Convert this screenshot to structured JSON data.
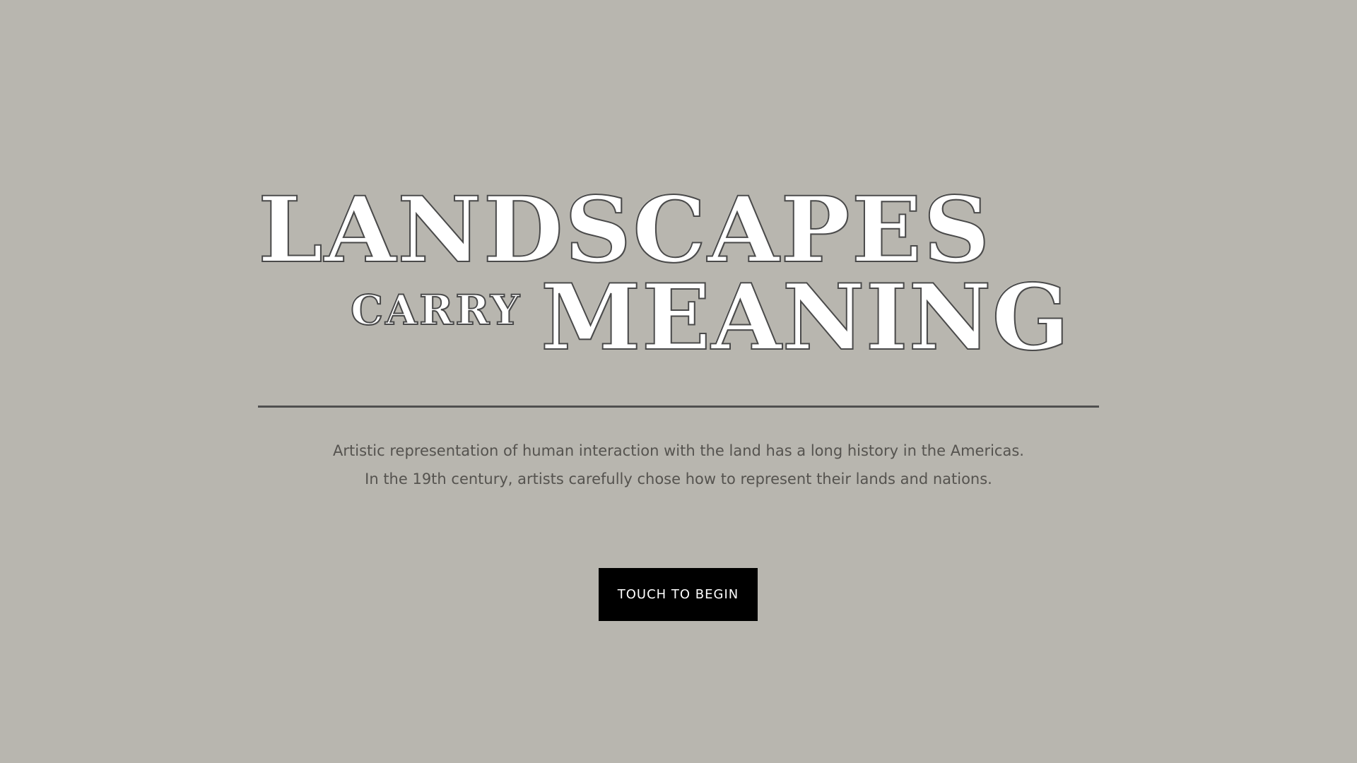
{
  "hero": {
    "title_line1": "LANDSCAPES",
    "title_small": "CARRY",
    "title_line2": "MEANING"
  },
  "intro": {
    "line1": "Artistic representation of human interaction with the land has a long history in the Americas.",
    "line2": "In the 19th century, artists carefully chose how to represent their lands and nations."
  },
  "cta": {
    "label": "TOUCH TO BEGIN"
  },
  "colors": {
    "background": "#b8b6af",
    "title_fill": "#ffffff",
    "title_outline": "#4a4a4a",
    "rule": "#4f4f4f",
    "body_text": "#55534f",
    "button_bg": "#000000",
    "button_text": "#ffffff"
  }
}
